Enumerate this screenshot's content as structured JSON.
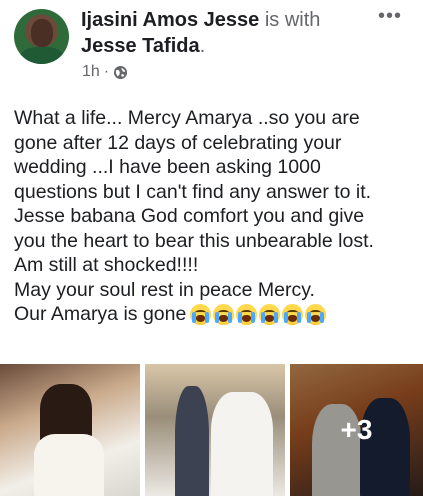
{
  "post": {
    "author": "Ijasini Amos Jesse",
    "with_word": "is with",
    "tagged": "Jesse Tafida",
    "tagged_suffix": ".",
    "time": "1h",
    "dot": "·",
    "privacy_icon": "globe-icon",
    "options_icon": "more-options-icon",
    "options_glyph": "•••",
    "text_lines": [
      "What a life... Mercy Amarya ..so you are",
      "gone after 12 days of celebrating your",
      "wedding ...I have been asking 1000",
      "questions but I can't find any answer to it.",
      "Jesse babana God comfort you and give",
      "you the heart to bear this unbearable lost.",
      "Am still at shocked!!!!",
      "May your soul rest in peace Mercy.",
      "Our Amarya is gone"
    ],
    "emoji_count": 6,
    "emoji_name": "loudly-crying-face"
  },
  "photos": {
    "count_visible": 3,
    "more_label": "+3"
  },
  "colors": {
    "text": "#1c1e21",
    "muted": "#65676b",
    "background": "#ffffff"
  }
}
